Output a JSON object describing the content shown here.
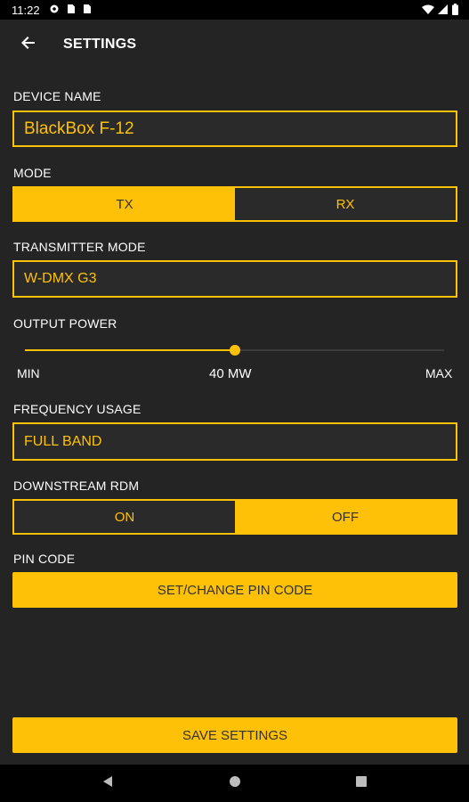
{
  "status_bar": {
    "time": "11:22"
  },
  "app_bar": {
    "title": "SETTINGS"
  },
  "device_name": {
    "label": "DEVICE NAME",
    "value": "BlackBox F-12"
  },
  "mode": {
    "label": "MODE",
    "options": [
      "TX",
      "RX"
    ],
    "selected": "TX"
  },
  "transmitter_mode": {
    "label": "TRANSMITTER MODE",
    "value": "W-DMX G3"
  },
  "output_power": {
    "label": "OUTPUT POWER",
    "min_label": "MIN",
    "max_label": "MAX",
    "value_label": "40 MW",
    "level": 0.5
  },
  "frequency_usage": {
    "label": "FREQUENCY USAGE",
    "value": "FULL BAND"
  },
  "downstream_rdm": {
    "label": "DOWNSTREAM RDM",
    "options": [
      "ON",
      "OFF"
    ],
    "selected": "OFF"
  },
  "pin_code": {
    "label": "PIN CODE",
    "button_label": "SET/CHANGE PIN CODE"
  },
  "save_button": {
    "label": "SAVE SETTINGS"
  },
  "colors": {
    "accent": "#FFC107",
    "background": "#242424",
    "field_background": "#2a2a2a"
  },
  "icons": [
    "settings-gear-icon",
    "sim-card-icon",
    "wifi-icon",
    "signal-icon",
    "battery-icon",
    "back-arrow-icon",
    "nav-back-icon",
    "nav-home-icon",
    "nav-recents-icon"
  ]
}
